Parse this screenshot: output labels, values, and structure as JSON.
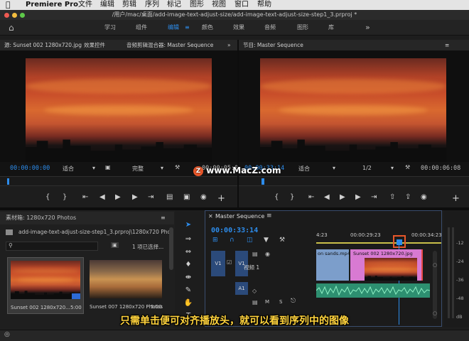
{
  "menubar": {
    "app": "Premiere Pro",
    "items": [
      "文件",
      "编辑",
      "剪辑",
      "序列",
      "标记",
      "图形",
      "视图",
      "窗口",
      "帮助"
    ]
  },
  "title": "/用户/mac/桌面/add-image-text-adjust-size/add-image-text-adjust-size-step1_3.prproj *",
  "workspaces": {
    "items": [
      "学习",
      "组件",
      "编辑",
      "颜色",
      "效果",
      "音频",
      "图形",
      "库"
    ],
    "active": "编辑",
    "more": "»"
  },
  "source_monitor": {
    "tabs": [
      "源: Sunset 002 1280x720.jpg",
      "效果控件",
      "音频剪辑混合器: Master Sequence"
    ],
    "timecode_in": "00:00:00:00",
    "fit": "适合",
    "quality": "完整",
    "timecode_out": "00:00:05:00"
  },
  "program_monitor": {
    "title": "节目: Master Sequence",
    "timecode": "00:00:33:14",
    "fit": "适合",
    "ratio": "1/2",
    "duration": "00:00:06:08"
  },
  "watermark": "www.MacZ.com",
  "project": {
    "title": "素材箱: 1280x720 Photos",
    "path": "add-image-text-adjust-size-step1_3.prproj\\1280x720 Photos",
    "selection": "1 项已选择...",
    "thumbs": [
      {
        "name": "Sunset 002 1280x720...",
        "dur": "5:00"
      },
      {
        "name": "Sunset 007 1280x720 Photos",
        "dur": "5:00"
      }
    ]
  },
  "sequence": {
    "title": "Master Sequence",
    "timecode": "00:00:33:14",
    "ruler": [
      "4:23",
      "00:00:29:23",
      "00:00:34:23"
    ],
    "tracks": {
      "v1": "V1",
      "v1_inner": "V1",
      "video_label": "视频 1",
      "a1": "A1",
      "m": "M",
      "s": "S"
    },
    "clips": {
      "clip1": "on sands.mp4",
      "clip2": "Sunset 002 1280x720.jpg"
    }
  },
  "meter": {
    "ticks": [
      "-12",
      "-24",
      "-36",
      "-48",
      "dB"
    ]
  },
  "subtitle": "只需单击便可对齐播放头，就可以看到序列中的图像",
  "colors": {
    "accent": "#2d8ceb",
    "subtitle": "#ffd33d",
    "clip_pink": "#d87ad2",
    "audio_green": "#3fbf8f",
    "highlight": "#e8572a"
  }
}
